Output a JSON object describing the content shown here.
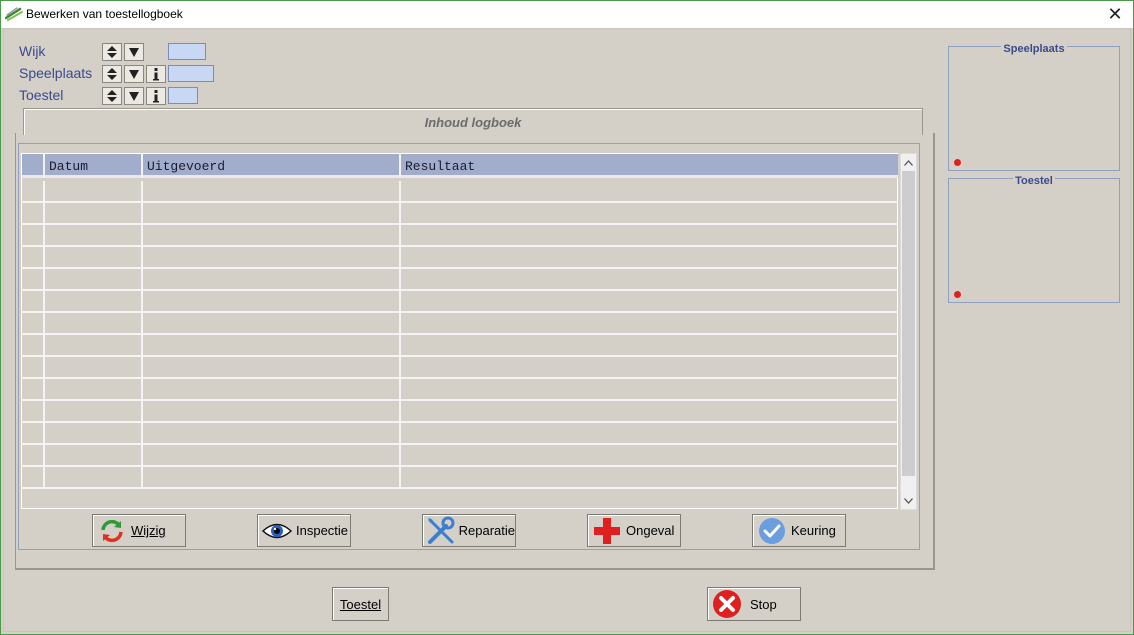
{
  "window": {
    "title": "Bewerken van toestellogboek",
    "close_glyph": "✕"
  },
  "filters": [
    {
      "label": "Wijk",
      "has_info": false
    },
    {
      "label": "Speelplaats",
      "has_info": true
    },
    {
      "label": "Toestel",
      "has_info": true
    }
  ],
  "tab": {
    "title": "Inhoud logboek"
  },
  "grid": {
    "columns": [
      "Datum",
      "Uitgevoerd",
      "Resultaat"
    ],
    "rows": [
      [
        "",
        "",
        ""
      ],
      [
        "",
        "",
        ""
      ],
      [
        "",
        "",
        ""
      ],
      [
        "",
        "",
        ""
      ],
      [
        "",
        "",
        ""
      ],
      [
        "",
        "",
        ""
      ],
      [
        "",
        "",
        ""
      ],
      [
        "",
        "",
        ""
      ],
      [
        "",
        "",
        ""
      ],
      [
        "",
        "",
        ""
      ],
      [
        "",
        "",
        ""
      ],
      [
        "",
        "",
        ""
      ],
      [
        "",
        "",
        ""
      ],
      [
        "",
        "",
        ""
      ]
    ]
  },
  "actions": [
    {
      "label": "Wijzig",
      "icon": "refresh-icon",
      "mnemonic": "W"
    },
    {
      "label": "Inspectie",
      "icon": "eye-icon",
      "mnemonic": "I"
    },
    {
      "label": "Reparatie",
      "icon": "wrench-screwdriver-icon",
      "mnemonic": "R"
    },
    {
      "label": "Ongeval",
      "icon": "red-cross-icon",
      "mnemonic": "O"
    },
    {
      "label": "Keuring",
      "icon": "checkmark-icon",
      "mnemonic": "K"
    }
  ],
  "side_panels": {
    "speelplaats_title": "Speelplaats",
    "toestel_title": "Toestel"
  },
  "bottom": {
    "toestel_label": "Toestel",
    "stop_label": "Stop"
  },
  "colors": {
    "label_blue": "#3b4a8c",
    "lookup_field": "#c8d8f4",
    "grid_header": "#a2adcb",
    "indicator_red": "#e02020"
  }
}
